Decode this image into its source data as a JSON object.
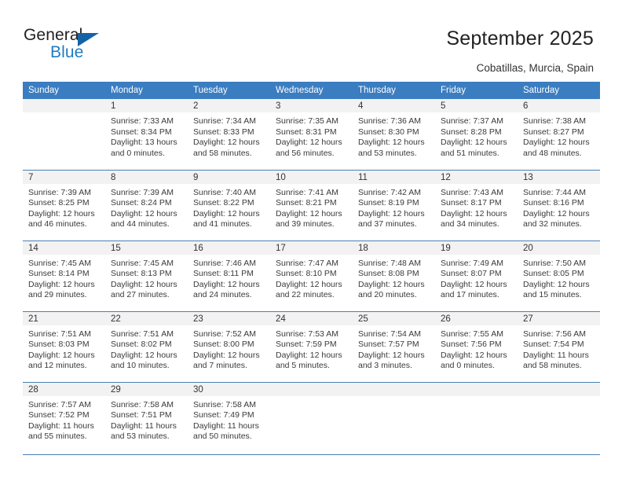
{
  "brand": {
    "name_part1": "General",
    "name_part2": "Blue",
    "accent_color": "#1f7bc1",
    "triangle_color": "#1463a6",
    "logo_icon": "triangle-flag-icon"
  },
  "header": {
    "title": "September 2025",
    "subtitle": "Cobatillas, Murcia, Spain"
  },
  "calendar": {
    "header_bg": "#3b7dc1",
    "daynum_bg": "#f2f2f2",
    "grid_line_color": "#4a7fb5",
    "weekday_headers": [
      "Sunday",
      "Monday",
      "Tuesday",
      "Wednesday",
      "Thursday",
      "Friday",
      "Saturday"
    ],
    "weeks": [
      [
        {
          "day": "",
          "sunrise": "",
          "sunset": "",
          "daylight1": "",
          "daylight2": ""
        },
        {
          "day": "1",
          "sunrise": "Sunrise: 7:33 AM",
          "sunset": "Sunset: 8:34 PM",
          "daylight1": "Daylight: 13 hours",
          "daylight2": "and 0 minutes."
        },
        {
          "day": "2",
          "sunrise": "Sunrise: 7:34 AM",
          "sunset": "Sunset: 8:33 PM",
          "daylight1": "Daylight: 12 hours",
          "daylight2": "and 58 minutes."
        },
        {
          "day": "3",
          "sunrise": "Sunrise: 7:35 AM",
          "sunset": "Sunset: 8:31 PM",
          "daylight1": "Daylight: 12 hours",
          "daylight2": "and 56 minutes."
        },
        {
          "day": "4",
          "sunrise": "Sunrise: 7:36 AM",
          "sunset": "Sunset: 8:30 PM",
          "daylight1": "Daylight: 12 hours",
          "daylight2": "and 53 minutes."
        },
        {
          "day": "5",
          "sunrise": "Sunrise: 7:37 AM",
          "sunset": "Sunset: 8:28 PM",
          "daylight1": "Daylight: 12 hours",
          "daylight2": "and 51 minutes."
        },
        {
          "day": "6",
          "sunrise": "Sunrise: 7:38 AM",
          "sunset": "Sunset: 8:27 PM",
          "daylight1": "Daylight: 12 hours",
          "daylight2": "and 48 minutes."
        }
      ],
      [
        {
          "day": "7",
          "sunrise": "Sunrise: 7:39 AM",
          "sunset": "Sunset: 8:25 PM",
          "daylight1": "Daylight: 12 hours",
          "daylight2": "and 46 minutes."
        },
        {
          "day": "8",
          "sunrise": "Sunrise: 7:39 AM",
          "sunset": "Sunset: 8:24 PM",
          "daylight1": "Daylight: 12 hours",
          "daylight2": "and 44 minutes."
        },
        {
          "day": "9",
          "sunrise": "Sunrise: 7:40 AM",
          "sunset": "Sunset: 8:22 PM",
          "daylight1": "Daylight: 12 hours",
          "daylight2": "and 41 minutes."
        },
        {
          "day": "10",
          "sunrise": "Sunrise: 7:41 AM",
          "sunset": "Sunset: 8:21 PM",
          "daylight1": "Daylight: 12 hours",
          "daylight2": "and 39 minutes."
        },
        {
          "day": "11",
          "sunrise": "Sunrise: 7:42 AM",
          "sunset": "Sunset: 8:19 PM",
          "daylight1": "Daylight: 12 hours",
          "daylight2": "and 37 minutes."
        },
        {
          "day": "12",
          "sunrise": "Sunrise: 7:43 AM",
          "sunset": "Sunset: 8:17 PM",
          "daylight1": "Daylight: 12 hours",
          "daylight2": "and 34 minutes."
        },
        {
          "day": "13",
          "sunrise": "Sunrise: 7:44 AM",
          "sunset": "Sunset: 8:16 PM",
          "daylight1": "Daylight: 12 hours",
          "daylight2": "and 32 minutes."
        }
      ],
      [
        {
          "day": "14",
          "sunrise": "Sunrise: 7:45 AM",
          "sunset": "Sunset: 8:14 PM",
          "daylight1": "Daylight: 12 hours",
          "daylight2": "and 29 minutes."
        },
        {
          "day": "15",
          "sunrise": "Sunrise: 7:45 AM",
          "sunset": "Sunset: 8:13 PM",
          "daylight1": "Daylight: 12 hours",
          "daylight2": "and 27 minutes."
        },
        {
          "day": "16",
          "sunrise": "Sunrise: 7:46 AM",
          "sunset": "Sunset: 8:11 PM",
          "daylight1": "Daylight: 12 hours",
          "daylight2": "and 24 minutes."
        },
        {
          "day": "17",
          "sunrise": "Sunrise: 7:47 AM",
          "sunset": "Sunset: 8:10 PM",
          "daylight1": "Daylight: 12 hours",
          "daylight2": "and 22 minutes."
        },
        {
          "day": "18",
          "sunrise": "Sunrise: 7:48 AM",
          "sunset": "Sunset: 8:08 PM",
          "daylight1": "Daylight: 12 hours",
          "daylight2": "and 20 minutes."
        },
        {
          "day": "19",
          "sunrise": "Sunrise: 7:49 AM",
          "sunset": "Sunset: 8:07 PM",
          "daylight1": "Daylight: 12 hours",
          "daylight2": "and 17 minutes."
        },
        {
          "day": "20",
          "sunrise": "Sunrise: 7:50 AM",
          "sunset": "Sunset: 8:05 PM",
          "daylight1": "Daylight: 12 hours",
          "daylight2": "and 15 minutes."
        }
      ],
      [
        {
          "day": "21",
          "sunrise": "Sunrise: 7:51 AM",
          "sunset": "Sunset: 8:03 PM",
          "daylight1": "Daylight: 12 hours",
          "daylight2": "and 12 minutes."
        },
        {
          "day": "22",
          "sunrise": "Sunrise: 7:51 AM",
          "sunset": "Sunset: 8:02 PM",
          "daylight1": "Daylight: 12 hours",
          "daylight2": "and 10 minutes."
        },
        {
          "day": "23",
          "sunrise": "Sunrise: 7:52 AM",
          "sunset": "Sunset: 8:00 PM",
          "daylight1": "Daylight: 12 hours",
          "daylight2": "and 7 minutes."
        },
        {
          "day": "24",
          "sunrise": "Sunrise: 7:53 AM",
          "sunset": "Sunset: 7:59 PM",
          "daylight1": "Daylight: 12 hours",
          "daylight2": "and 5 minutes."
        },
        {
          "day": "25",
          "sunrise": "Sunrise: 7:54 AM",
          "sunset": "Sunset: 7:57 PM",
          "daylight1": "Daylight: 12 hours",
          "daylight2": "and 3 minutes."
        },
        {
          "day": "26",
          "sunrise": "Sunrise: 7:55 AM",
          "sunset": "Sunset: 7:56 PM",
          "daylight1": "Daylight: 12 hours",
          "daylight2": "and 0 minutes."
        },
        {
          "day": "27",
          "sunrise": "Sunrise: 7:56 AM",
          "sunset": "Sunset: 7:54 PM",
          "daylight1": "Daylight: 11 hours",
          "daylight2": "and 58 minutes."
        }
      ],
      [
        {
          "day": "28",
          "sunrise": "Sunrise: 7:57 AM",
          "sunset": "Sunset: 7:52 PM",
          "daylight1": "Daylight: 11 hours",
          "daylight2": "and 55 minutes."
        },
        {
          "day": "29",
          "sunrise": "Sunrise: 7:58 AM",
          "sunset": "Sunset: 7:51 PM",
          "daylight1": "Daylight: 11 hours",
          "daylight2": "and 53 minutes."
        },
        {
          "day": "30",
          "sunrise": "Sunrise: 7:58 AM",
          "sunset": "Sunset: 7:49 PM",
          "daylight1": "Daylight: 11 hours",
          "daylight2": "and 50 minutes."
        },
        {
          "day": "",
          "sunrise": "",
          "sunset": "",
          "daylight1": "",
          "daylight2": ""
        },
        {
          "day": "",
          "sunrise": "",
          "sunset": "",
          "daylight1": "",
          "daylight2": ""
        },
        {
          "day": "",
          "sunrise": "",
          "sunset": "",
          "daylight1": "",
          "daylight2": ""
        },
        {
          "day": "",
          "sunrise": "",
          "sunset": "",
          "daylight1": "",
          "daylight2": ""
        }
      ]
    ]
  }
}
